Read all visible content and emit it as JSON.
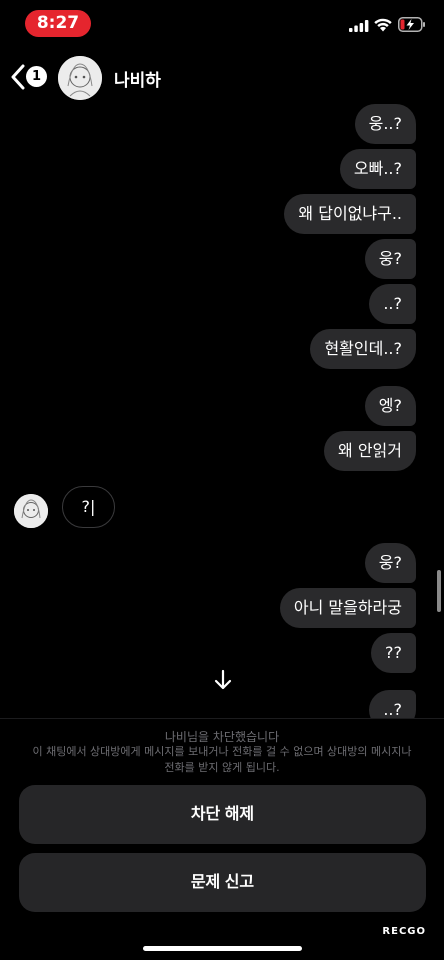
{
  "status_bar": {
    "time": "8:27",
    "time_pill_color": "#e5252e",
    "icons": [
      "cellular-signal-icon",
      "wifi-icon",
      "battery-charging-icon"
    ]
  },
  "header": {
    "unread_count": "1",
    "contact_name": "나비하",
    "back_icon": "chevron-left-icon"
  },
  "messages": {
    "sent_1": "웅..?",
    "sent_2": "오빠..?",
    "sent_3": "왜 답이없냐구..",
    "sent_4": "웅?",
    "sent_5": "..?",
    "sent_6": "현활인데..?",
    "sent_7": "엥?",
    "sent_8": "왜 안읽거",
    "received_1": "?|",
    "sent_9": "웅?",
    "sent_10": "아니 말을하라궁",
    "sent_11": "??",
    "sent_12": "..?"
  },
  "blocked": {
    "title": "나비님을 차단했습니다",
    "description": "이 채팅에서 상대방에게 메시지를 보내거나 전화를 걸 수 없으며 상대방의 메시지나 전화를 받지 않게 됩니다.",
    "unblock_label": "차단 해제",
    "report_label": "문제 신고"
  },
  "watermark": "RECGO",
  "colors": {
    "background": "#000000",
    "bubble": "#2a2a2c",
    "button": "#262628",
    "muted_text": "#6d6d72"
  }
}
